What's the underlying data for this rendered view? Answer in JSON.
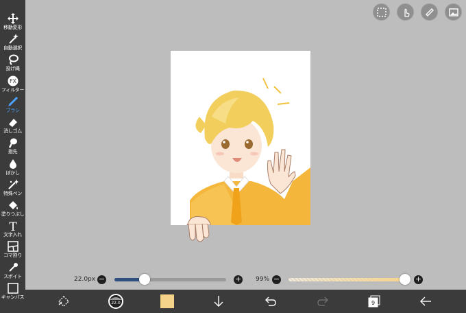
{
  "left_toolbar": {
    "items": [
      {
        "label": "移動変形",
        "icon": "move-icon"
      },
      {
        "label": "自動選択",
        "icon": "magic-wand-icon"
      },
      {
        "label": "投げ縄",
        "icon": "lasso-icon"
      },
      {
        "label": "フィルター",
        "icon": "fx-icon"
      },
      {
        "label": "ブラシ",
        "icon": "brush-icon",
        "active": true
      },
      {
        "label": "消しゴム",
        "icon": "eraser-icon"
      },
      {
        "label": "指先",
        "icon": "finger-icon"
      },
      {
        "label": "ぼかし",
        "icon": "blur-icon"
      },
      {
        "label": "特殊ペン",
        "icon": "special-pen-icon"
      },
      {
        "label": "塗りつぶし",
        "icon": "fill-icon"
      },
      {
        "label": "文字入れ",
        "icon": "text-icon"
      },
      {
        "label": "コマ割り",
        "icon": "frame-divider-icon"
      },
      {
        "label": "スポイト",
        "icon": "eyedropper-icon"
      },
      {
        "label": "キャンバス",
        "icon": "canvas-icon"
      }
    ],
    "fx_text": "FX",
    "text_tool_glyph": "T"
  },
  "top_right_buttons": [
    "selection-icon",
    "touch-icon",
    "ruler-icon",
    "image-icon"
  ],
  "brush_size": {
    "value_text": "22.0px",
    "minus": "−",
    "plus": "+",
    "level": 0.27
  },
  "opacity": {
    "value_text": "99%",
    "minus": "−",
    "plus": "+",
    "level": 0.99
  },
  "bottom_bar": {
    "brush_size_badge": "22.0",
    "current_color": "#f5d38a",
    "layer_count": "9",
    "icons": [
      "transform-icon",
      "brush-size-icon",
      "color-swatch",
      "download-icon",
      "undo-icon",
      "redo-icon",
      "layers-icon",
      "back-arrow-icon"
    ]
  },
  "colors": {
    "accent": "#4da3ff",
    "toolbar": "#3b3b3b",
    "workspace": "#bdbdbd",
    "slider_fill": "#2f4f7f"
  }
}
